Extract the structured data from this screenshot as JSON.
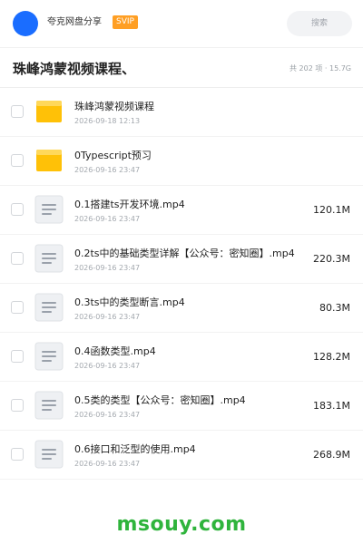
{
  "header": {
    "username": "夸克网盘分享",
    "badge": "SVIP",
    "search_placeholder": "搜索"
  },
  "folder": {
    "title": "珠峰鸿蒙视频课程、",
    "summary": "共 202 项 · 15.7G"
  },
  "files": [
    {
      "type": "folder",
      "icon": "folder-icon",
      "name": "珠峰鸿蒙视频课程",
      "date": "2026-09-18 12:13",
      "size": ""
    },
    {
      "type": "folder",
      "icon": "folder-icon",
      "name": "0Typescript预习",
      "date": "2026-09-16 23:47",
      "size": ""
    },
    {
      "type": "file",
      "icon": "file-icon",
      "name": "0.1搭建ts开发环境.mp4",
      "date": "2026-09-16 23:47",
      "size": "120.1M"
    },
    {
      "type": "file",
      "icon": "file-icon",
      "name": "0.2ts中的基础类型详解【公众号：密知圈】.mp4",
      "date": "2026-09-16 23:47",
      "size": "220.3M"
    },
    {
      "type": "file",
      "icon": "file-icon",
      "name": "0.3ts中的类型断言.mp4",
      "date": "2026-09-16 23:47",
      "size": "80.3M"
    },
    {
      "type": "file",
      "icon": "file-icon",
      "name": "0.4函数类型.mp4",
      "date": "2026-09-16 23:47",
      "size": "128.2M"
    },
    {
      "type": "file",
      "icon": "file-icon",
      "name": "0.5类的类型【公众号：密知圈】.mp4",
      "date": "2026-09-16 23:47",
      "size": "183.1M"
    },
    {
      "type": "file",
      "icon": "file-icon",
      "name": "0.6接口和泛型的使用.mp4",
      "date": "2026-09-16 23:47",
      "size": "268.9M"
    }
  ],
  "watermark": "msouy.com",
  "colors": {
    "avatar": "#1a6dff",
    "badge": "#ff9f24",
    "folder": "#ffc107",
    "watermark": "#2fb43c"
  }
}
